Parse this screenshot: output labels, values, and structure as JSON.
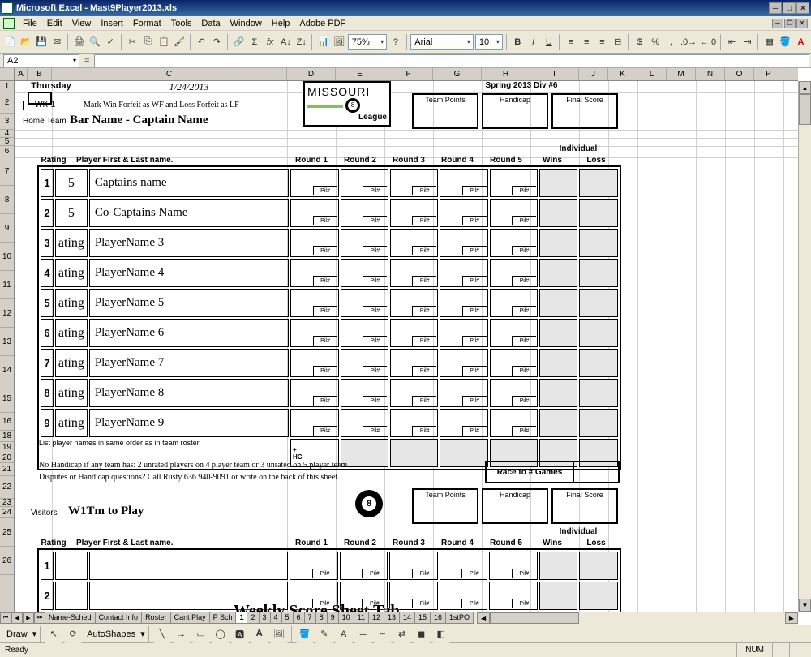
{
  "window": {
    "title": "Microsoft Excel - Mast9Player2013.xls"
  },
  "menu": [
    "File",
    "Edit",
    "View",
    "Insert",
    "Format",
    "Tools",
    "Data",
    "Window",
    "Help",
    "Adobe PDF"
  ],
  "toolbar": {
    "zoom": "75%",
    "font": "Arial",
    "size": "10"
  },
  "formula": {
    "cellref": "A2",
    "value": ""
  },
  "column_letters": [
    "A",
    "B",
    "C",
    "D",
    "E",
    "F",
    "G",
    "H",
    "I",
    "J",
    "K",
    "L",
    "M",
    "N",
    "O",
    "P"
  ],
  "row_numbers": [
    1,
    2,
    3,
    4,
    5,
    6,
    7,
    8,
    9,
    10,
    11,
    12,
    13,
    14,
    15,
    16,
    18,
    19,
    20,
    21,
    22,
    23,
    24,
    25,
    26
  ],
  "sheet": {
    "day": "Thursday",
    "date": "1/24/2013",
    "wk": "WK-1",
    "forfeit_note": "Mark Win Forfeit as WF and Loss Forfeit as LF",
    "home_team_label": "Home Team",
    "bar_caption": "Bar Name - Captain Name",
    "season": "Spring 2013 Div #6",
    "score_labels": {
      "team_points": "Team Points",
      "handicap": "Handicap",
      "final_score": "Final Score"
    },
    "col_labels": {
      "rating": "Rating",
      "name": "Player First & Last name.",
      "r1": "Round 1",
      "r2": "Round 2",
      "r3": "Round 3",
      "r4": "Round 4",
      "r5": "Round 5",
      "wins": "Wins",
      "loss": "Loss",
      "individual": "Individual",
      "pil": "Pil#"
    },
    "players": [
      {
        "n": "1",
        "rating": "5",
        "name": "Captains name"
      },
      {
        "n": "2",
        "rating": "5",
        "name": "Co-Captains Name"
      },
      {
        "n": "3",
        "rating": "ating",
        "name": "PlayerName 3"
      },
      {
        "n": "4",
        "rating": "ating",
        "name": "PlayerName 4"
      },
      {
        "n": "5",
        "rating": "ating",
        "name": "PlayerName 5"
      },
      {
        "n": "6",
        "rating": "ating",
        "name": "PlayerName 6"
      },
      {
        "n": "7",
        "rating": "ating",
        "name": "PlayerName 7"
      },
      {
        "n": "8",
        "rating": "ating",
        "name": "PlayerName 8"
      },
      {
        "n": "9",
        "rating": "ating",
        "name": "PlayerName 9"
      }
    ],
    "hc_row": {
      "plus": "+",
      "hc": "HC"
    },
    "roster_note": "List player names in same order as in team roster.",
    "handicap_note1": "No Handicap if any team has: 2 unrated players on 4 player team or 3 unrated on 5 player team.",
    "handicap_note2": "Disputes or Handicap questions? Call Rusty 636 940-9091 or write on the back of this sheet.",
    "race_label": "Race to # Games",
    "visitors_label": "Visitors",
    "visitors_name": "W1Tm to Play",
    "watermark": "Weekly Score Sheet Tab"
  },
  "tabs": [
    "Name-Sched",
    "Contact Info",
    "Roster",
    "Cant Play",
    "P Sch",
    "1",
    "2",
    "3",
    "4",
    "5",
    "6",
    "7",
    "8",
    "9",
    "10",
    "11",
    "12",
    "13",
    "14",
    "15",
    "16",
    "1stPO"
  ],
  "active_tab_index": 5,
  "drawbar": {
    "draw": "Draw",
    "autoshapes": "AutoShapes"
  },
  "status": {
    "ready": "Ready",
    "num": "NUM"
  }
}
